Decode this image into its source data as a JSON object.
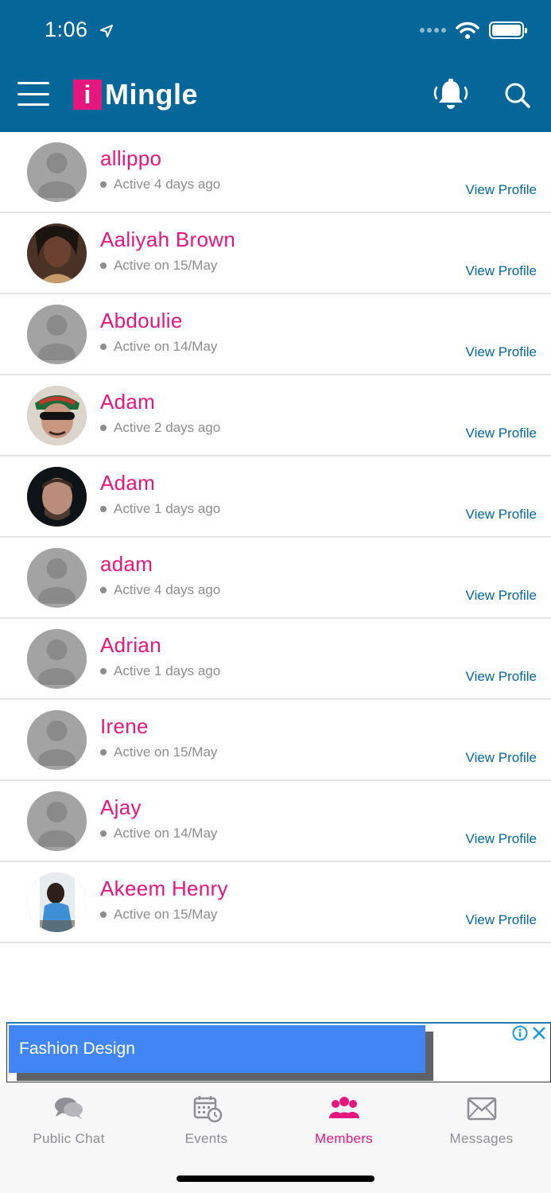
{
  "status_bar": {
    "time": "1:06"
  },
  "app": {
    "logo_letter": "i",
    "logo_text": "Mingle",
    "brand_color": "#e4177f",
    "header_color": "#05669a"
  },
  "members": [
    {
      "name": "allippo",
      "status": "Active 4 days ago",
      "action": "View Profile",
      "avatar": "placeholder"
    },
    {
      "name": "Aaliyah Brown",
      "status": "Active on 15/May",
      "action": "View Profile",
      "avatar": "photo"
    },
    {
      "name": "Abdoulie",
      "status": "Active on 14/May",
      "action": "View Profile",
      "avatar": "placeholder"
    },
    {
      "name": "Adam",
      "status": "Active 2 days ago",
      "action": "View Profile",
      "avatar": "photo"
    },
    {
      "name": "Adam",
      "status": "Active 1 days ago",
      "action": "View Profile",
      "avatar": "photo"
    },
    {
      "name": "adam",
      "status": "Active 4 days ago",
      "action": "View Profile",
      "avatar": "placeholder"
    },
    {
      "name": "Adrian",
      "status": "Active 1 days ago",
      "action": "View Profile",
      "avatar": "placeholder"
    },
    {
      "name": "Irene",
      "status": "Active on 15/May",
      "action": "View Profile",
      "avatar": "placeholder"
    },
    {
      "name": "Ajay",
      "status": "Active on 14/May",
      "action": "View Profile",
      "avatar": "placeholder"
    },
    {
      "name": "Akeem Henry",
      "status": "Active on 15/May",
      "action": "View Profile",
      "avatar": "photo"
    }
  ],
  "ad": {
    "label": "Fashion Design"
  },
  "tabs": [
    {
      "label": "Public Chat",
      "icon": "chat-bubbles-icon",
      "active": false
    },
    {
      "label": "Events",
      "icon": "calendar-clock-icon",
      "active": false
    },
    {
      "label": "Members",
      "icon": "group-icon",
      "active": true
    },
    {
      "label": "Messages",
      "icon": "envelope-icon",
      "active": false
    }
  ]
}
